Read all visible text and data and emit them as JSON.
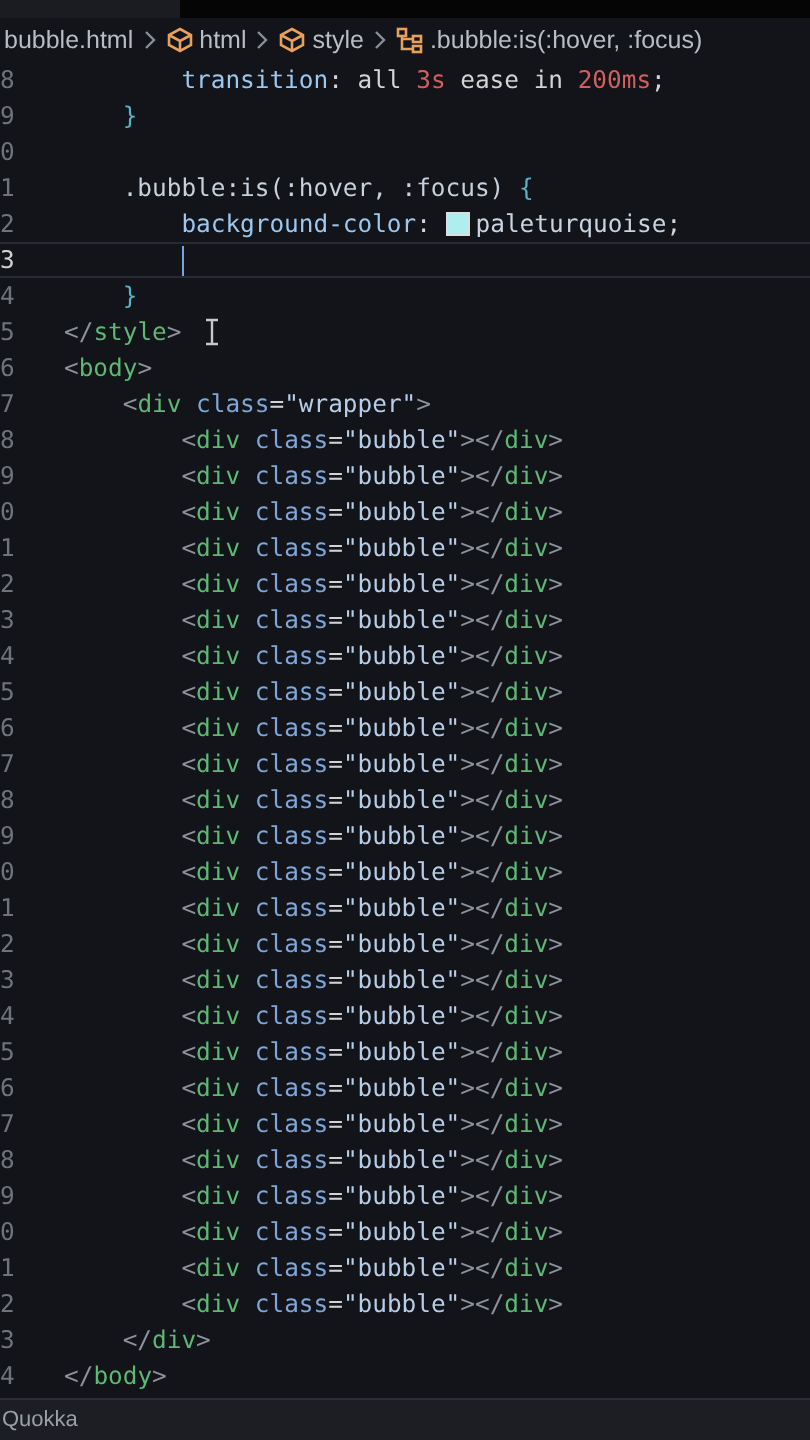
{
  "breadcrumb": [
    {
      "kind": "file",
      "label": "bubble.html"
    },
    {
      "kind": "element",
      "label": "html"
    },
    {
      "kind": "element",
      "label": "style"
    },
    {
      "kind": "selector",
      "label": ".bubble:is(:hover, :focus)"
    }
  ],
  "lines": [
    {
      "number": "8",
      "current": false,
      "tokens": [
        {
          "kind": "prop",
          "text": "        transition"
        },
        {
          "kind": "plain",
          "text": ": all "
        },
        {
          "kind": "num",
          "text": "3s"
        },
        {
          "kind": "plain",
          "text": " ease in "
        },
        {
          "kind": "num",
          "text": "200ms"
        },
        {
          "kind": "plain",
          "text": ";"
        }
      ]
    },
    {
      "number": "9",
      "current": false,
      "tokens": [
        {
          "kind": "brace",
          "text": "    }"
        }
      ]
    },
    {
      "number": "0",
      "current": false
    },
    {
      "number": "1",
      "current": false,
      "tokens": [
        {
          "kind": "selector",
          "text": "    .bubble:is(:hover, :focus) "
        },
        {
          "kind": "brace",
          "text": "{"
        }
      ]
    },
    {
      "number": "2",
      "current": false,
      "tokens": [
        {
          "kind": "prop",
          "text": "        background-color"
        },
        {
          "kind": "plain",
          "text": ": "
        },
        {
          "kind": "swatch",
          "color": "#afeeee"
        },
        {
          "kind": "value",
          "text": "paleturquoise"
        },
        {
          "kind": "plain",
          "text": ";"
        }
      ]
    },
    {
      "number": "3",
      "current": true,
      "tokens": [
        {
          "kind": "caret"
        }
      ]
    },
    {
      "number": "4",
      "current": false,
      "tokens": [
        {
          "kind": "brace",
          "text": "    }"
        }
      ]
    },
    {
      "number": "5",
      "current": false,
      "tokens": [
        {
          "kind": "punct",
          "text": "</"
        },
        {
          "kind": "tag",
          "text": "style"
        },
        {
          "kind": "punct",
          "text": ">"
        }
      ]
    },
    {
      "number": "6",
      "current": false,
      "tokens": [
        {
          "kind": "punct",
          "text": "<"
        },
        {
          "kind": "tag",
          "text": "body"
        },
        {
          "kind": "punct",
          "text": ">"
        }
      ]
    },
    {
      "number": "7",
      "current": false,
      "tokens": [
        {
          "kind": "punct",
          "text": "    <"
        },
        {
          "kind": "tag",
          "text": "div"
        },
        {
          "kind": "attr",
          "text": " class"
        },
        {
          "kind": "plain",
          "text": "="
        },
        {
          "kind": "string",
          "text": "\"wrapper\""
        },
        {
          "kind": "punct",
          "text": ">"
        }
      ]
    },
    {
      "number": "8",
      "current": false,
      "tokens": [
        {
          "kind": "punct",
          "text": "        <"
        },
        {
          "kind": "tag",
          "text": "div"
        },
        {
          "kind": "attr",
          "text": " class"
        },
        {
          "kind": "plain",
          "text": "="
        },
        {
          "kind": "string",
          "text": "\"bubble\""
        },
        {
          "kind": "punct",
          "text": "></"
        },
        {
          "kind": "tag",
          "text": "div"
        },
        {
          "kind": "punct",
          "text": ">"
        }
      ]
    },
    {
      "number": "9",
      "current": false,
      "tokens": [
        {
          "kind": "punct",
          "text": "        <"
        },
        {
          "kind": "tag",
          "text": "div"
        },
        {
          "kind": "attr",
          "text": " class"
        },
        {
          "kind": "plain",
          "text": "="
        },
        {
          "kind": "string",
          "text": "\"bubble\""
        },
        {
          "kind": "punct",
          "text": "></"
        },
        {
          "kind": "tag",
          "text": "div"
        },
        {
          "kind": "punct",
          "text": ">"
        }
      ]
    },
    {
      "number": "0",
      "current": false,
      "tokens": [
        {
          "kind": "punct",
          "text": "        <"
        },
        {
          "kind": "tag",
          "text": "div"
        },
        {
          "kind": "attr",
          "text": " class"
        },
        {
          "kind": "plain",
          "text": "="
        },
        {
          "kind": "string",
          "text": "\"bubble\""
        },
        {
          "kind": "punct",
          "text": "></"
        },
        {
          "kind": "tag",
          "text": "div"
        },
        {
          "kind": "punct",
          "text": ">"
        }
      ]
    },
    {
      "number": "1",
      "current": false,
      "tokens": [
        {
          "kind": "punct",
          "text": "        <"
        },
        {
          "kind": "tag",
          "text": "div"
        },
        {
          "kind": "attr",
          "text": " class"
        },
        {
          "kind": "plain",
          "text": "="
        },
        {
          "kind": "string",
          "text": "\"bubble\""
        },
        {
          "kind": "punct",
          "text": "></"
        },
        {
          "kind": "tag",
          "text": "div"
        },
        {
          "kind": "punct",
          "text": ">"
        }
      ]
    },
    {
      "number": "2",
      "current": false,
      "tokens": [
        {
          "kind": "punct",
          "text": "        <"
        },
        {
          "kind": "tag",
          "text": "div"
        },
        {
          "kind": "attr",
          "text": " class"
        },
        {
          "kind": "plain",
          "text": "="
        },
        {
          "kind": "string",
          "text": "\"bubble\""
        },
        {
          "kind": "punct",
          "text": "></"
        },
        {
          "kind": "tag",
          "text": "div"
        },
        {
          "kind": "punct",
          "text": ">"
        }
      ]
    },
    {
      "number": "3",
      "current": false,
      "tokens": [
        {
          "kind": "punct",
          "text": "        <"
        },
        {
          "kind": "tag",
          "text": "div"
        },
        {
          "kind": "attr",
          "text": " class"
        },
        {
          "kind": "plain",
          "text": "="
        },
        {
          "kind": "string",
          "text": "\"bubble\""
        },
        {
          "kind": "punct",
          "text": "></"
        },
        {
          "kind": "tag",
          "text": "div"
        },
        {
          "kind": "punct",
          "text": ">"
        }
      ]
    },
    {
      "number": "4",
      "current": false,
      "tokens": [
        {
          "kind": "punct",
          "text": "        <"
        },
        {
          "kind": "tag",
          "text": "div"
        },
        {
          "kind": "attr",
          "text": " class"
        },
        {
          "kind": "plain",
          "text": "="
        },
        {
          "kind": "string",
          "text": "\"bubble\""
        },
        {
          "kind": "punct",
          "text": "></"
        },
        {
          "kind": "tag",
          "text": "div"
        },
        {
          "kind": "punct",
          "text": ">"
        }
      ]
    },
    {
      "number": "5",
      "current": false,
      "tokens": [
        {
          "kind": "punct",
          "text": "        <"
        },
        {
          "kind": "tag",
          "text": "div"
        },
        {
          "kind": "attr",
          "text": " class"
        },
        {
          "kind": "plain",
          "text": "="
        },
        {
          "kind": "string",
          "text": "\"bubble\""
        },
        {
          "kind": "punct",
          "text": "></"
        },
        {
          "kind": "tag",
          "text": "div"
        },
        {
          "kind": "punct",
          "text": ">"
        }
      ]
    },
    {
      "number": "6",
      "current": false,
      "tokens": [
        {
          "kind": "punct",
          "text": "        <"
        },
        {
          "kind": "tag",
          "text": "div"
        },
        {
          "kind": "attr",
          "text": " class"
        },
        {
          "kind": "plain",
          "text": "="
        },
        {
          "kind": "string",
          "text": "\"bubble\""
        },
        {
          "kind": "punct",
          "text": "></"
        },
        {
          "kind": "tag",
          "text": "div"
        },
        {
          "kind": "punct",
          "text": ">"
        }
      ]
    },
    {
      "number": "7",
      "current": false,
      "tokens": [
        {
          "kind": "punct",
          "text": "        <"
        },
        {
          "kind": "tag",
          "text": "div"
        },
        {
          "kind": "attr",
          "text": " class"
        },
        {
          "kind": "plain",
          "text": "="
        },
        {
          "kind": "string",
          "text": "\"bubble\""
        },
        {
          "kind": "punct",
          "text": "></"
        },
        {
          "kind": "tag",
          "text": "div"
        },
        {
          "kind": "punct",
          "text": ">"
        }
      ]
    },
    {
      "number": "8",
      "current": false,
      "tokens": [
        {
          "kind": "punct",
          "text": "        <"
        },
        {
          "kind": "tag",
          "text": "div"
        },
        {
          "kind": "attr",
          "text": " class"
        },
        {
          "kind": "plain",
          "text": "="
        },
        {
          "kind": "string",
          "text": "\"bubble\""
        },
        {
          "kind": "punct",
          "text": "></"
        },
        {
          "kind": "tag",
          "text": "div"
        },
        {
          "kind": "punct",
          "text": ">"
        }
      ]
    },
    {
      "number": "9",
      "current": false,
      "tokens": [
        {
          "kind": "punct",
          "text": "        <"
        },
        {
          "kind": "tag",
          "text": "div"
        },
        {
          "kind": "attr",
          "text": " class"
        },
        {
          "kind": "plain",
          "text": "="
        },
        {
          "kind": "string",
          "text": "\"bubble\""
        },
        {
          "kind": "punct",
          "text": "></"
        },
        {
          "kind": "tag",
          "text": "div"
        },
        {
          "kind": "punct",
          "text": ">"
        }
      ]
    },
    {
      "number": "0",
      "current": false,
      "tokens": [
        {
          "kind": "punct",
          "text": "        <"
        },
        {
          "kind": "tag",
          "text": "div"
        },
        {
          "kind": "attr",
          "text": " class"
        },
        {
          "kind": "plain",
          "text": "="
        },
        {
          "kind": "string",
          "text": "\"bubble\""
        },
        {
          "kind": "punct",
          "text": "></"
        },
        {
          "kind": "tag",
          "text": "div"
        },
        {
          "kind": "punct",
          "text": ">"
        }
      ]
    },
    {
      "number": "1",
      "current": false,
      "tokens": [
        {
          "kind": "punct",
          "text": "        <"
        },
        {
          "kind": "tag",
          "text": "div"
        },
        {
          "kind": "attr",
          "text": " class"
        },
        {
          "kind": "plain",
          "text": "="
        },
        {
          "kind": "string",
          "text": "\"bubble\""
        },
        {
          "kind": "punct",
          "text": "></"
        },
        {
          "kind": "tag",
          "text": "div"
        },
        {
          "kind": "punct",
          "text": ">"
        }
      ]
    },
    {
      "number": "2",
      "current": false,
      "tokens": [
        {
          "kind": "punct",
          "text": "        <"
        },
        {
          "kind": "tag",
          "text": "div"
        },
        {
          "kind": "attr",
          "text": " class"
        },
        {
          "kind": "plain",
          "text": "="
        },
        {
          "kind": "string",
          "text": "\"bubble\""
        },
        {
          "kind": "punct",
          "text": "></"
        },
        {
          "kind": "tag",
          "text": "div"
        },
        {
          "kind": "punct",
          "text": ">"
        }
      ]
    },
    {
      "number": "3",
      "current": false,
      "tokens": [
        {
          "kind": "punct",
          "text": "        <"
        },
        {
          "kind": "tag",
          "text": "div"
        },
        {
          "kind": "attr",
          "text": " class"
        },
        {
          "kind": "plain",
          "text": "="
        },
        {
          "kind": "string",
          "text": "\"bubble\""
        },
        {
          "kind": "punct",
          "text": "></"
        },
        {
          "kind": "tag",
          "text": "div"
        },
        {
          "kind": "punct",
          "text": ">"
        }
      ]
    },
    {
      "number": "4",
      "current": false,
      "tokens": [
        {
          "kind": "punct",
          "text": "        <"
        },
        {
          "kind": "tag",
          "text": "div"
        },
        {
          "kind": "attr",
          "text": " class"
        },
        {
          "kind": "plain",
          "text": "="
        },
        {
          "kind": "string",
          "text": "\"bubble\""
        },
        {
          "kind": "punct",
          "text": "></"
        },
        {
          "kind": "tag",
          "text": "div"
        },
        {
          "kind": "punct",
          "text": ">"
        }
      ]
    },
    {
      "number": "5",
      "current": false,
      "tokens": [
        {
          "kind": "punct",
          "text": "        <"
        },
        {
          "kind": "tag",
          "text": "div"
        },
        {
          "kind": "attr",
          "text": " class"
        },
        {
          "kind": "plain",
          "text": "="
        },
        {
          "kind": "string",
          "text": "\"bubble\""
        },
        {
          "kind": "punct",
          "text": "></"
        },
        {
          "kind": "tag",
          "text": "div"
        },
        {
          "kind": "punct",
          "text": ">"
        }
      ]
    },
    {
      "number": "6",
      "current": false,
      "tokens": [
        {
          "kind": "punct",
          "text": "        <"
        },
        {
          "kind": "tag",
          "text": "div"
        },
        {
          "kind": "attr",
          "text": " class"
        },
        {
          "kind": "plain",
          "text": "="
        },
        {
          "kind": "string",
          "text": "\"bubble\""
        },
        {
          "kind": "punct",
          "text": "></"
        },
        {
          "kind": "tag",
          "text": "div"
        },
        {
          "kind": "punct",
          "text": ">"
        }
      ]
    },
    {
      "number": "7",
      "current": false,
      "tokens": [
        {
          "kind": "punct",
          "text": "        <"
        },
        {
          "kind": "tag",
          "text": "div"
        },
        {
          "kind": "attr",
          "text": " class"
        },
        {
          "kind": "plain",
          "text": "="
        },
        {
          "kind": "string",
          "text": "\"bubble\""
        },
        {
          "kind": "punct",
          "text": "></"
        },
        {
          "kind": "tag",
          "text": "div"
        },
        {
          "kind": "punct",
          "text": ">"
        }
      ]
    },
    {
      "number": "8",
      "current": false,
      "tokens": [
        {
          "kind": "punct",
          "text": "        <"
        },
        {
          "kind": "tag",
          "text": "div"
        },
        {
          "kind": "attr",
          "text": " class"
        },
        {
          "kind": "plain",
          "text": "="
        },
        {
          "kind": "string",
          "text": "\"bubble\""
        },
        {
          "kind": "punct",
          "text": "></"
        },
        {
          "kind": "tag",
          "text": "div"
        },
        {
          "kind": "punct",
          "text": ">"
        }
      ]
    },
    {
      "number": "9",
      "current": false,
      "tokens": [
        {
          "kind": "punct",
          "text": "        <"
        },
        {
          "kind": "tag",
          "text": "div"
        },
        {
          "kind": "attr",
          "text": " class"
        },
        {
          "kind": "plain",
          "text": "="
        },
        {
          "kind": "string",
          "text": "\"bubble\""
        },
        {
          "kind": "punct",
          "text": "></"
        },
        {
          "kind": "tag",
          "text": "div"
        },
        {
          "kind": "punct",
          "text": ">"
        }
      ]
    },
    {
      "number": "0",
      "current": false,
      "tokens": [
        {
          "kind": "punct",
          "text": "        <"
        },
        {
          "kind": "tag",
          "text": "div"
        },
        {
          "kind": "attr",
          "text": " class"
        },
        {
          "kind": "plain",
          "text": "="
        },
        {
          "kind": "string",
          "text": "\"bubble\""
        },
        {
          "kind": "punct",
          "text": "></"
        },
        {
          "kind": "tag",
          "text": "div"
        },
        {
          "kind": "punct",
          "text": ">"
        }
      ]
    },
    {
      "number": "1",
      "current": false,
      "tokens": [
        {
          "kind": "punct",
          "text": "        <"
        },
        {
          "kind": "tag",
          "text": "div"
        },
        {
          "kind": "attr",
          "text": " class"
        },
        {
          "kind": "plain",
          "text": "="
        },
        {
          "kind": "string",
          "text": "\"bubble\""
        },
        {
          "kind": "punct",
          "text": "></"
        },
        {
          "kind": "tag",
          "text": "div"
        },
        {
          "kind": "punct",
          "text": ">"
        }
      ]
    },
    {
      "number": "2",
      "current": false,
      "tokens": [
        {
          "kind": "punct",
          "text": "        <"
        },
        {
          "kind": "tag",
          "text": "div"
        },
        {
          "kind": "attr",
          "text": " class"
        },
        {
          "kind": "plain",
          "text": "="
        },
        {
          "kind": "string",
          "text": "\"bubble\""
        },
        {
          "kind": "punct",
          "text": "></"
        },
        {
          "kind": "tag",
          "text": "div"
        },
        {
          "kind": "punct",
          "text": ">"
        }
      ]
    },
    {
      "number": "3",
      "current": false,
      "tokens": [
        {
          "kind": "punct",
          "text": "    </"
        },
        {
          "kind": "tag",
          "text": "div"
        },
        {
          "kind": "punct",
          "text": ">"
        }
      ]
    },
    {
      "number": "4",
      "current": false,
      "tokens": [
        {
          "kind": "punct",
          "text": "</"
        },
        {
          "kind": "tag",
          "text": "body"
        },
        {
          "kind": "punct",
          "text": ">"
        }
      ]
    }
  ],
  "status_bar": {
    "label": "Quokka"
  }
}
